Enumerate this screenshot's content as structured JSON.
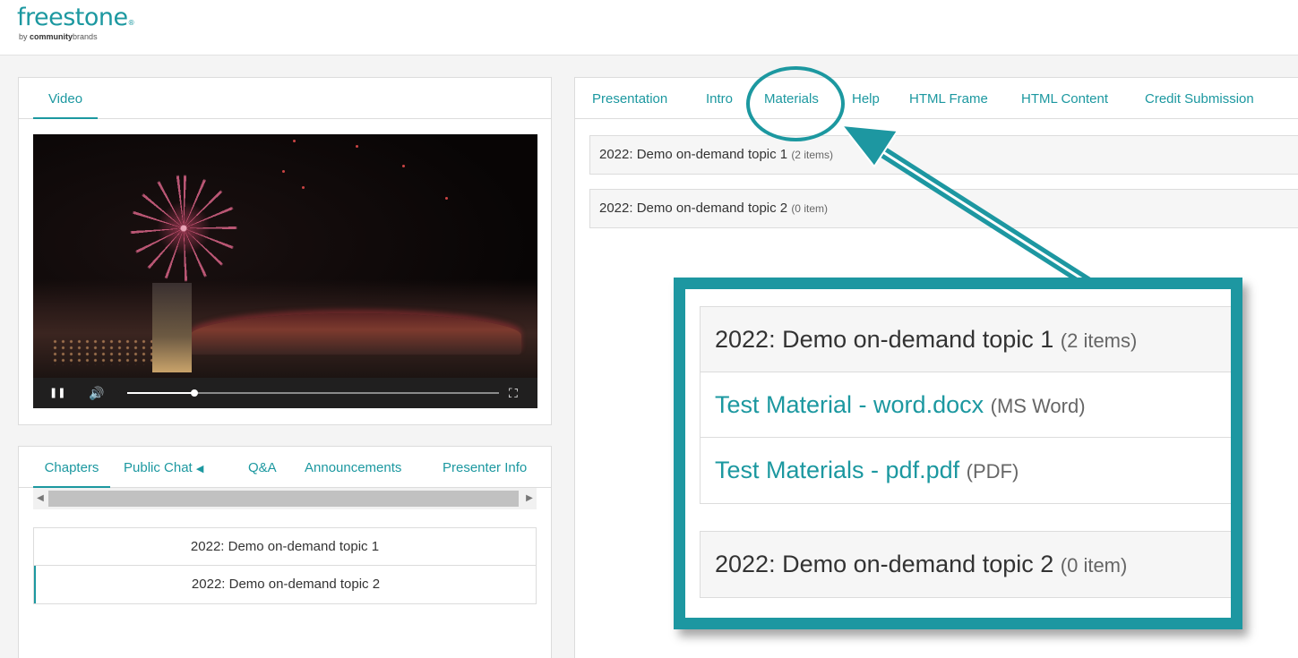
{
  "brand": {
    "name": "freestone",
    "registered": "®",
    "tagline_prefix": "by",
    "tagline_bold": "community",
    "tagline_rest": "brands"
  },
  "video_panel": {
    "tab": "Video"
  },
  "video_player": {
    "progress": 0.18,
    "pause_glyph": "❚❚",
    "volume_glyph": "🔊",
    "fullscreen_glyph": "⛶"
  },
  "chapters_panel": {
    "tabs": [
      "Chapters",
      "Public Chat",
      "Q&A",
      "Announcements",
      "Presenter Info"
    ],
    "chat_arrow": "◀",
    "scroll_left": "◀",
    "scroll_right": "▶",
    "items": [
      "2022: Demo on-demand topic 1",
      "2022: Demo on-demand topic 2"
    ]
  },
  "right_panel": {
    "tabs": [
      "Presentation",
      "Intro",
      "Materials",
      "Help",
      "HTML Frame",
      "HTML Content",
      "Credit Submission"
    ],
    "active_tab": "Materials",
    "groups": [
      {
        "title": "2022: Demo on-demand topic 1",
        "count": "(2 items)"
      },
      {
        "title": "2022: Demo on-demand topic 2",
        "count": "(0 item)"
      }
    ]
  },
  "callout": {
    "group1": {
      "title": "2022: Demo on-demand topic 1",
      "count": "(2 items)",
      "items": [
        {
          "name": "Test Material - word.docx",
          "kind": "(MS Word)"
        },
        {
          "name": "Test Materials - pdf.pdf",
          "kind": "(PDF)"
        }
      ]
    },
    "group2": {
      "title": "2022: Demo on-demand topic 2",
      "count": "(0 item)"
    }
  },
  "colors": {
    "accent": "#1c98a0",
    "callout_border": "#1d97a1"
  }
}
